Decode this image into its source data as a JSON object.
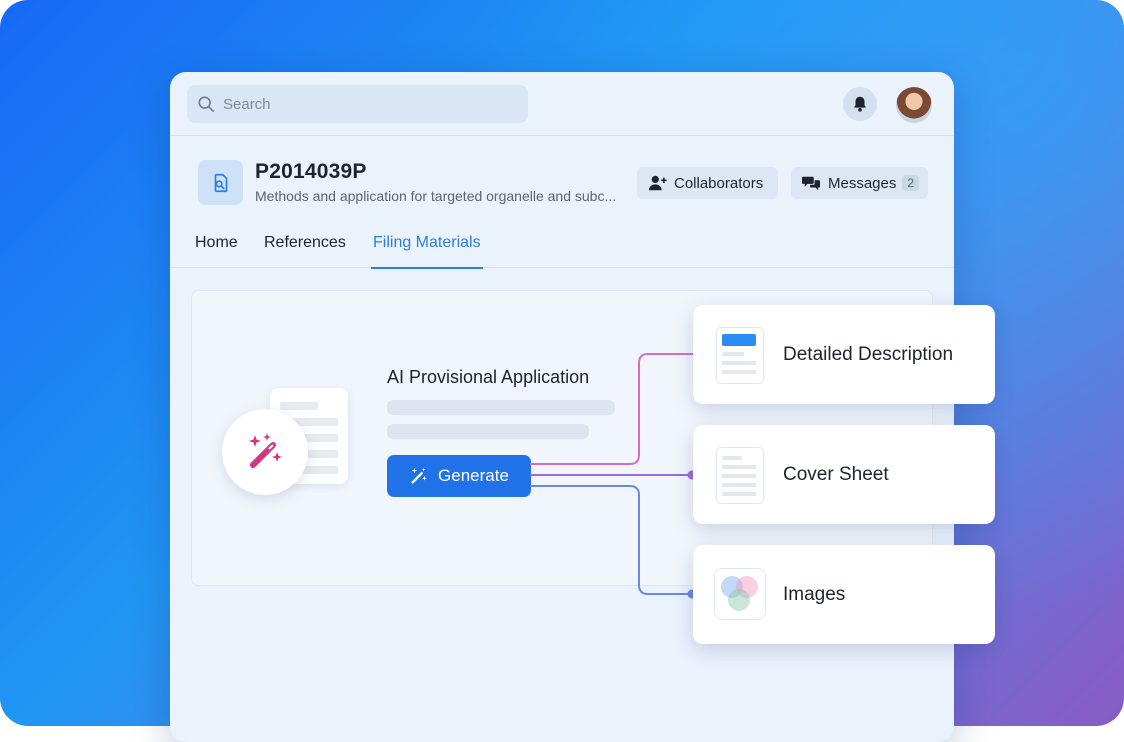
{
  "search": {
    "placeholder": "Search"
  },
  "project": {
    "id": "P2014039P",
    "description": "Methods and application for targeted organelle and subc..."
  },
  "header_buttons": {
    "collaborators": "Collaborators",
    "messages": "Messages",
    "messages_count": "2"
  },
  "tabs": [
    {
      "label": "Home",
      "active": false
    },
    {
      "label": "References",
      "active": false
    },
    {
      "label": "Filing Materials",
      "active": true
    }
  ],
  "generator": {
    "title": "AI Provisional Application",
    "button_label": "Generate"
  },
  "outputs": [
    {
      "label": "Detailed Description",
      "icon": "document-header-icon"
    },
    {
      "label": "Cover Sheet",
      "icon": "document-icon"
    },
    {
      "label": "Images",
      "icon": "images-icon"
    }
  ],
  "colors": {
    "accent": "#1f72e8",
    "tab_active": "#2f7de1",
    "wand": "#d63384",
    "connector_pink": "#d46fbe",
    "connector_purple": "#9a6be0",
    "connector_blue": "#6a87e6"
  }
}
